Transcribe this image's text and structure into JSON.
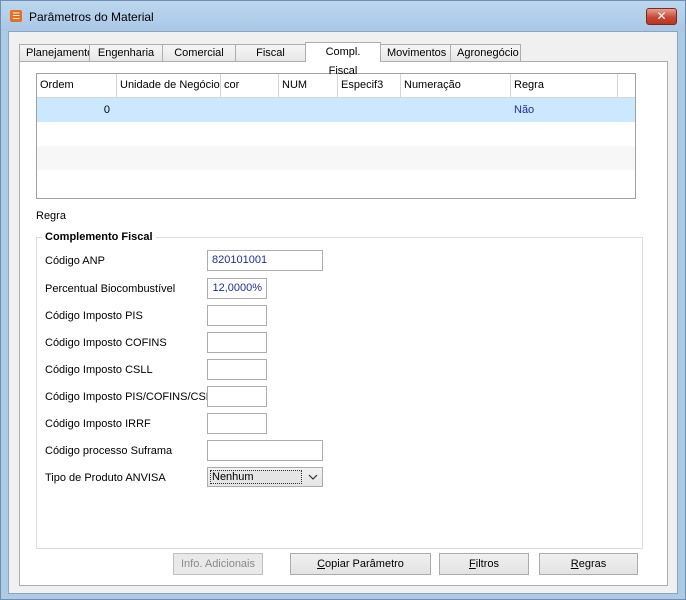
{
  "window": {
    "title": "Parâmetros do Material",
    "app_icon": "material-app-icon",
    "close_glyph": "✕"
  },
  "tabs": [
    {
      "label": "Planejamento",
      "active": false
    },
    {
      "label": "Engenharia",
      "active": false
    },
    {
      "label": "Comercial",
      "active": false
    },
    {
      "label": "Fiscal",
      "active": false
    },
    {
      "label": "Compl. Fiscal",
      "active": true
    },
    {
      "label": "Movimentos",
      "active": false
    },
    {
      "label": "Agronegócio",
      "active": false
    }
  ],
  "grid": {
    "columns": [
      "Ordem",
      "Unidade de Negócio",
      "cor",
      "NUM",
      "Especif3",
      "Numeração",
      "Regra"
    ],
    "rows": [
      {
        "ordem": "0",
        "unidade": "",
        "cor": "",
        "num": "",
        "especif3": "",
        "numeracao": "",
        "regra": "Não",
        "selected": true
      }
    ],
    "selection_color": "#cce8ff"
  },
  "regra_label": "Regra",
  "complemento": {
    "title": "Complemento Fiscal",
    "fields": [
      {
        "label": "Código ANP",
        "value": "820101001"
      },
      {
        "label": "Percentual Biocombustível",
        "value": "12,0000%"
      },
      {
        "label": "Código Imposto PIS",
        "value": ""
      },
      {
        "label": "Código Imposto COFINS",
        "value": ""
      },
      {
        "label": "Código Imposto CSLL",
        "value": ""
      },
      {
        "label": "Código Imposto PIS/COFINS/CSLL",
        "value": ""
      },
      {
        "label": "Código Imposto IRRF",
        "value": ""
      },
      {
        "label": "Código processo Suframa",
        "value": ""
      }
    ],
    "anvisa": {
      "label": "Tipo de Produto ANVISA",
      "selected": "Nenhum"
    }
  },
  "buttons": {
    "info": {
      "label": "Info. Adicionais",
      "enabled": false
    },
    "copiar": {
      "label": "Copiar Parâmetro",
      "mnemonic": "C"
    },
    "filtros": {
      "label": "Filtros",
      "mnemonic": "F"
    },
    "regras": {
      "label": "Regras",
      "mnemonic": "R"
    }
  }
}
